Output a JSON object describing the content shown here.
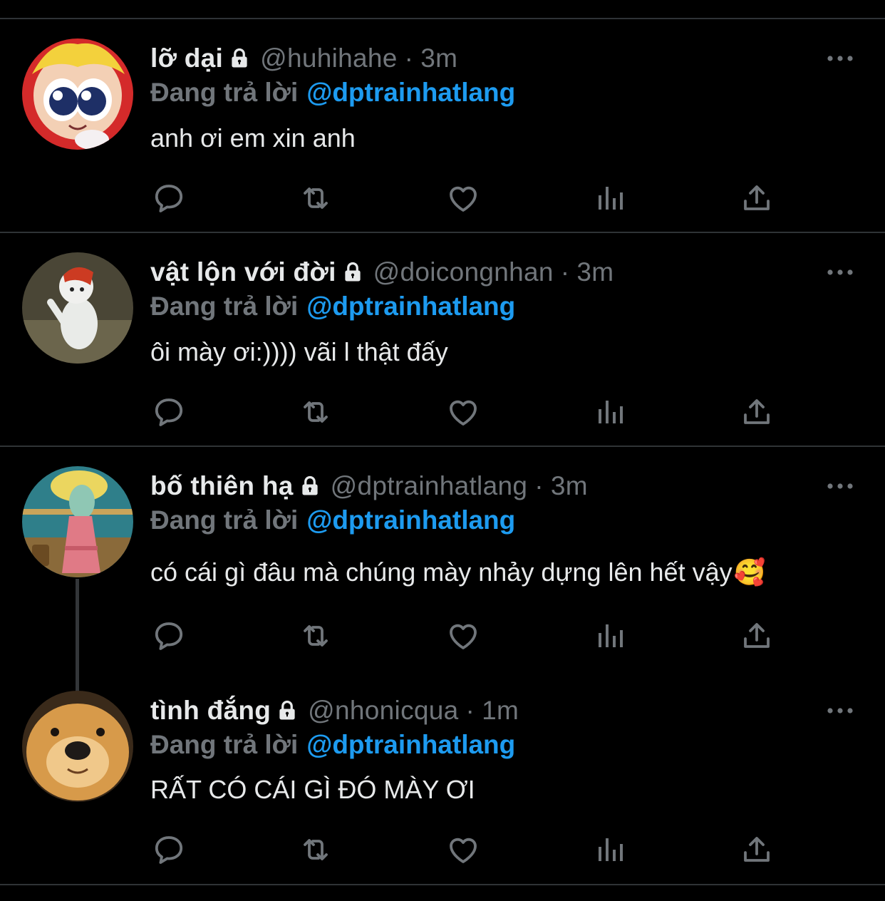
{
  "colors": {
    "background": "#000000",
    "text": "#e7e9ea",
    "muted": "#71767b",
    "accent": "#1d9bf0",
    "divider": "#2f3336"
  },
  "icons": {
    "lock": "lock-icon",
    "more": "more-icon",
    "reply": "reply-icon",
    "retweet": "retweet-icon",
    "like": "heart-icon",
    "analytics": "analytics-icon",
    "share": "share-icon"
  },
  "tweets": [
    {
      "name": "lỡ dại",
      "handle": "@huhihahe",
      "separator": "·",
      "time": "3m",
      "reply_prefix": "Đang trả lời",
      "reply_to": "@dptrainhatlang",
      "text": "anh ơi em xin anh",
      "emoji": ""
    },
    {
      "name": "vật lộn với đời",
      "handle": "@doicongnhan",
      "separator": "·",
      "time": "3m",
      "reply_prefix": "Đang trả lời",
      "reply_to": "@dptrainhatlang",
      "text": "ôi mày ơi:)))) vãi l thật đấy",
      "emoji": ""
    },
    {
      "name": "bố thiên hạ",
      "handle": "@dptrainhatlang",
      "separator": "·",
      "time": "3m",
      "reply_prefix": "Đang trả lời",
      "reply_to": "@dptrainhatlang",
      "text": "có cái gì đâu mà chúng mày nhảy dựng lên hết vậy",
      "emoji": "🥰"
    },
    {
      "name": "tình đắng",
      "handle": "@nhonicqua",
      "separator": "·",
      "time": "1m",
      "reply_prefix": "Đang trả lời",
      "reply_to": "@dptrainhatlang",
      "text": "RẤT CÓ CÁI GÌ ĐÓ MÀY ƠI",
      "emoji": ""
    }
  ]
}
